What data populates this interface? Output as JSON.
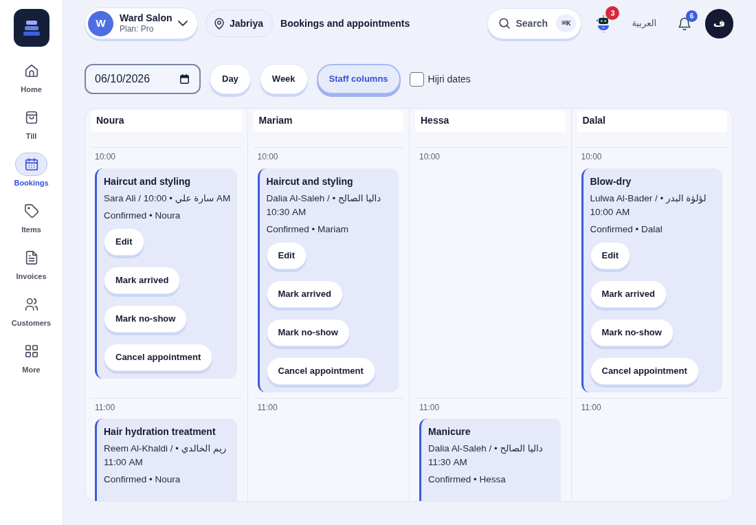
{
  "sidebar": {
    "items": [
      {
        "label": "Home",
        "selected": false
      },
      {
        "label": "Till",
        "selected": false
      },
      {
        "label": "Bookings",
        "selected": true
      },
      {
        "label": "Items",
        "selected": false
      },
      {
        "label": "Invoices",
        "selected": false
      },
      {
        "label": "Customers",
        "selected": false
      },
      {
        "label": "More",
        "selected": false
      }
    ]
  },
  "topbar": {
    "account": {
      "initial": "W",
      "name": "Ward Salon",
      "plan": "Plan: Pro"
    },
    "location": "Jabriya",
    "title": "Bookings and appointments",
    "search": {
      "label": "Search",
      "shortcut": "⌘K"
    },
    "assistant_badge": "3",
    "language": "العربية",
    "notifications_badge": "6",
    "avatar": "ف"
  },
  "toolbar": {
    "date": "06/10/2026",
    "views": [
      {
        "label": "Day",
        "selected": false
      },
      {
        "label": "Week",
        "selected": false
      },
      {
        "label": "Staff columns",
        "selected": true
      }
    ],
    "hijri": {
      "label": "Hijri dates",
      "checked": false
    }
  },
  "schedule": {
    "columns": [
      {
        "staff": "Noura",
        "slots": [
          {
            "time": "10:00",
            "appointments": [
              {
                "service": "Haircut and styling",
                "customer": "Sara Ali / سارة علي • 10:00 AM",
                "status": "Confirmed • Noura",
                "actions": [
                  "Edit",
                  "Mark arrived",
                  "Mark no-show",
                  "Cancel appointment"
                ]
              }
            ]
          },
          {
            "time": "11:00",
            "appointments": [
              {
                "service": "Hair hydration treatment",
                "customer": "Reem Al-Khaldi / ريم الخالدي • 11:00 AM",
                "status": "Confirmed • Noura"
              }
            ]
          }
        ]
      },
      {
        "staff": "Mariam",
        "slots": [
          {
            "time": "10:00",
            "appointments": [
              {
                "service": "Haircut and styling",
                "customer": "Dalia Al-Saleh / داليا الصالح • 10:30 AM",
                "status": "Confirmed • Mariam",
                "actions": [
                  "Edit",
                  "Mark arrived",
                  "Mark no-show",
                  "Cancel appointment"
                ]
              }
            ]
          },
          {
            "time": "11:00"
          }
        ]
      },
      {
        "staff": "Hessa",
        "slots": [
          {
            "time": "10:00"
          },
          {
            "time": "11:00",
            "appointments": [
              {
                "service": "Manicure",
                "customer": "Dalia Al-Saleh / داليا الصالح • 11:30 AM",
                "status": "Confirmed • Hessa"
              }
            ]
          }
        ]
      },
      {
        "staff": "Dalal",
        "slots": [
          {
            "time": "10:00",
            "appointments": [
              {
                "service": "Blow-dry",
                "customer": "Lulwa Al-Bader / لؤلؤة البدر • 10:00 AM",
                "status": "Confirmed • Dalal",
                "actions": [
                  "Edit",
                  "Mark arrived",
                  "Mark no-show",
                  "Cancel appointment"
                ]
              }
            ]
          },
          {
            "time": "11:00"
          }
        ]
      }
    ]
  }
}
